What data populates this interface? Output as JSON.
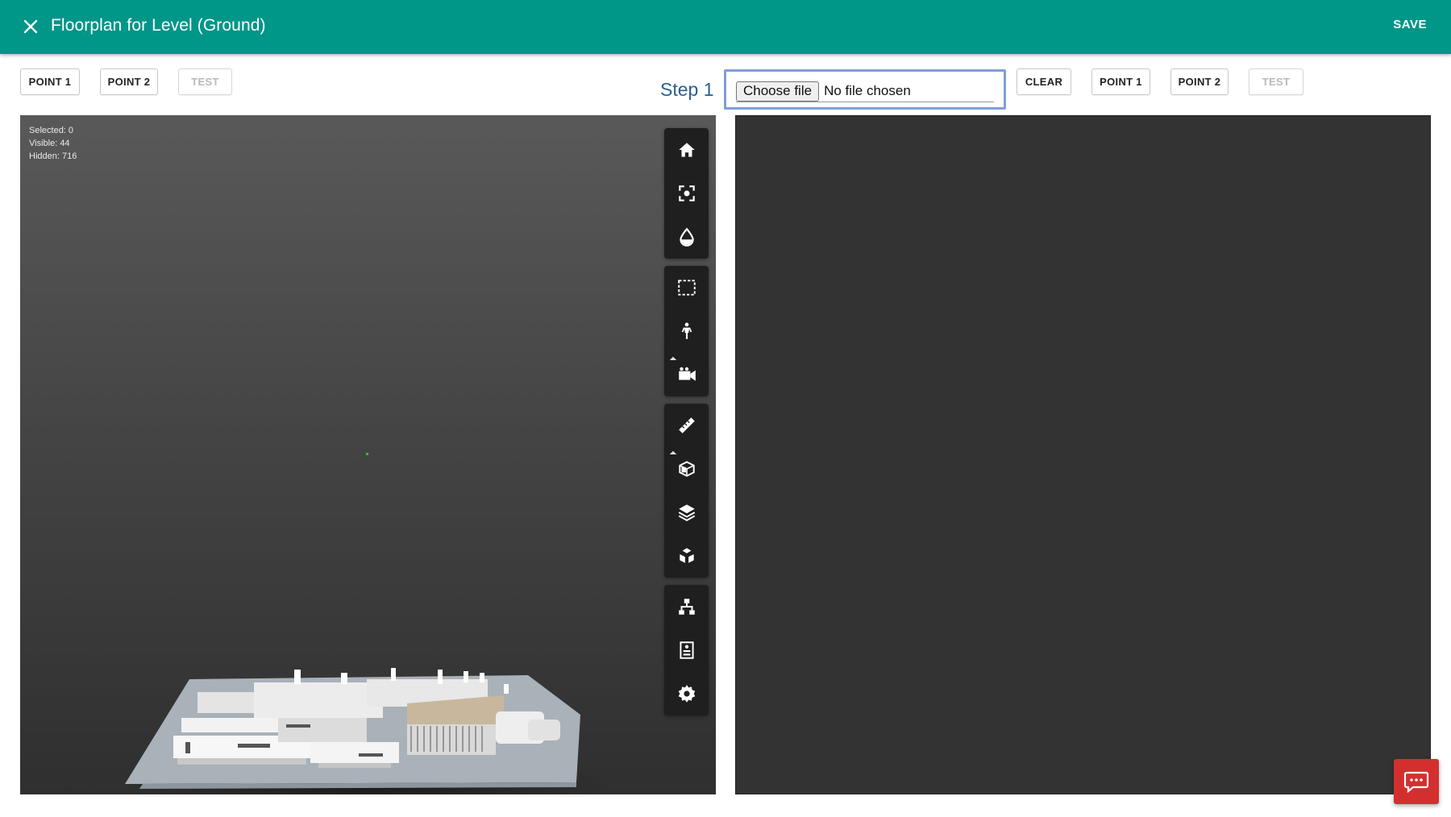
{
  "header": {
    "title": "Floorplan for Level (Ground)",
    "save_label": "SAVE",
    "close_icon": "close-icon"
  },
  "left_toolbar": {
    "point1_label": "POINT 1",
    "point2_label": "POINT 2",
    "test_label": "TEST"
  },
  "step": {
    "label": "Step 1"
  },
  "file_input": {
    "button_label": "Choose file",
    "status_text": "No file chosen"
  },
  "right_toolbar": {
    "clear_label": "CLEAR",
    "point1_label": "POINT 1",
    "point2_label": "POINT 2",
    "test_label": "TEST"
  },
  "viewer": {
    "selected": "Selected: 0",
    "visible": "Visible: 44",
    "hidden": "Hidden: 716",
    "tool_groups": [
      [
        "home-icon",
        "fit-view-icon",
        "render-mode-icon"
      ],
      [
        "box-select-icon",
        "first-person-icon",
        "camera-icon"
      ],
      [
        "measure-icon",
        "section-box-icon",
        "layers-icon",
        "explode-icon"
      ],
      [
        "model-tree-icon",
        "properties-icon",
        "settings-icon"
      ]
    ]
  },
  "chat": {
    "icon": "chat-icon"
  },
  "colors": {
    "header": "#009688",
    "step_label": "#2b5f94",
    "chat_button": "#d32f2f",
    "file_focus": "#7f9ed9"
  }
}
